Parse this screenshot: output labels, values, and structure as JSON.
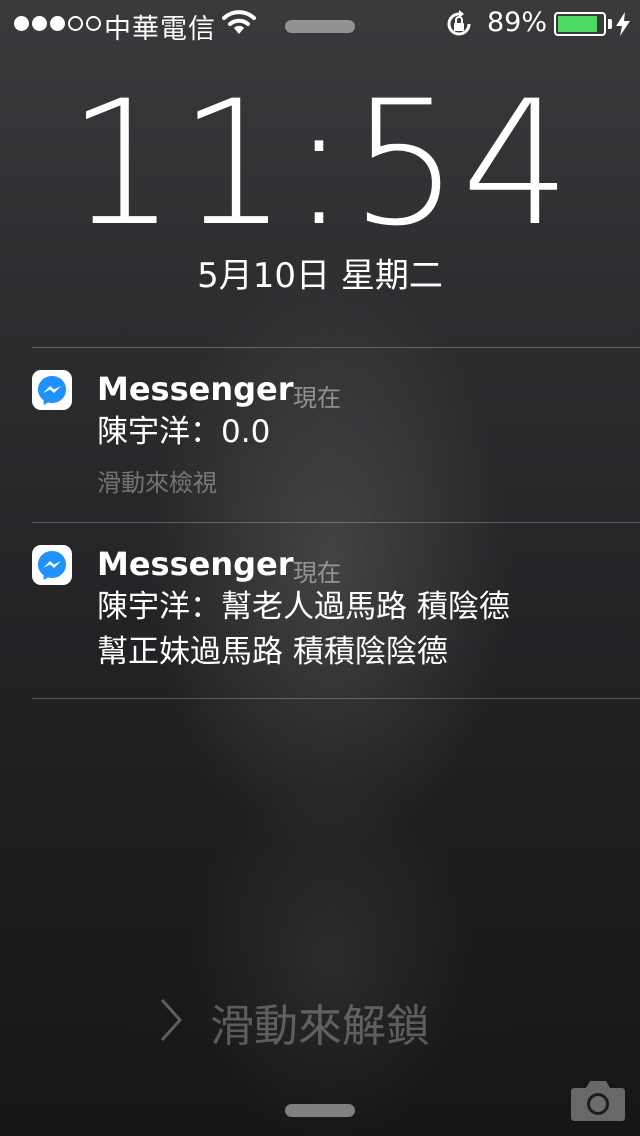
{
  "status_bar": {
    "carrier": "中華電信",
    "battery_percent": "89%",
    "battery_level": 0.89,
    "signal_bars_filled": 3,
    "signal_bars_total": 5,
    "icons": [
      "signal-dots-icon",
      "wifi-icon",
      "rotation-lock-icon",
      "battery-icon",
      "charging-bolt-icon"
    ]
  },
  "lock_screen": {
    "time": "11:54",
    "date": "5月10日 星期二",
    "unlock_hint": "滑動來解鎖",
    "camera_icon": "camera-icon"
  },
  "notifications": [
    {
      "app": "Messenger",
      "time": "現在",
      "message": "陳宇洋：0.0",
      "hint": "滑動來檢視",
      "icon": "messenger-icon"
    },
    {
      "app": "Messenger",
      "time": "現在",
      "message": "陳宇洋：幫老人過馬路 積陰德\n幫正妹過馬路 積積陰陰德",
      "icon": "messenger-icon"
    }
  ],
  "colors": {
    "battery_fill": "#4cd964",
    "messenger_blue": "#1e90ff"
  }
}
